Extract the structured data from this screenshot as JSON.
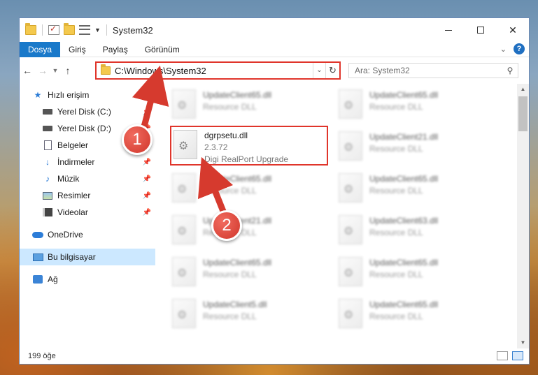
{
  "window": {
    "title": "System32"
  },
  "ribbon": {
    "tabs": [
      "Dosya",
      "Giriş",
      "Paylaş",
      "Görünüm"
    ],
    "active_index": 0
  },
  "address": {
    "path": "C:\\Windows\\System32"
  },
  "search": {
    "placeholder": "Ara: System32"
  },
  "sidebar": {
    "items": [
      {
        "label": "Hızlı erişim",
        "icon": "star-icon"
      },
      {
        "label": "Yerel Disk (C:)",
        "icon": "drive-icon",
        "pinned": true
      },
      {
        "label": "Yerel Disk (D:)",
        "icon": "drive-icon",
        "pinned": true
      },
      {
        "label": "Belgeler",
        "icon": "documents-icon",
        "pinned": true
      },
      {
        "label": "İndirmeler",
        "icon": "downloads-icon",
        "pinned": true
      },
      {
        "label": "Müzik",
        "icon": "music-icon",
        "pinned": true
      },
      {
        "label": "Resimler",
        "icon": "pictures-icon",
        "pinned": true
      },
      {
        "label": "Videolar",
        "icon": "videos-icon",
        "pinned": true
      },
      {
        "label": "OneDrive",
        "icon": "onedrive-icon"
      },
      {
        "label": "Bu bilgisayar",
        "icon": "this-pc-icon",
        "selected": true
      },
      {
        "label": "Ağ",
        "icon": "network-icon"
      }
    ]
  },
  "files": [
    {
      "name": "UpdateClient65.dll",
      "desc": "Resource DLL"
    },
    {
      "name": "UpdateClient65.dll",
      "desc": "Resource DLL"
    },
    {
      "name": "dgrpsetu.dll",
      "version": "2.3.72",
      "desc": "Digi RealPort Upgrade"
    },
    {
      "name": "UpdateClient21.dll",
      "desc": "Resource DLL"
    },
    {
      "name": "UpdateClient65.dll",
      "desc": "Resource DLL"
    },
    {
      "name": "UpdateClient65.dll",
      "desc": "Resource DLL"
    },
    {
      "name": "UpdateClient21.dll",
      "desc": "Resource DLL"
    },
    {
      "name": "UpdateClient63.dll",
      "desc": "Resource DLL"
    },
    {
      "name": "UpdateClient65.dll",
      "desc": "Resource DLL"
    },
    {
      "name": "UpdateClient65.dll",
      "desc": "Resource DLL"
    },
    {
      "name": "UpdateClient5.dll",
      "desc": "Resource DLL"
    },
    {
      "name": "UpdateClient65.dll",
      "desc": "Resource DLL"
    }
  ],
  "status": {
    "count": "199 öğe"
  },
  "callouts": [
    "1",
    "2"
  ],
  "colors": {
    "accent": "#1979ca",
    "highlight": "#e0352b",
    "selected": "#cce8ff"
  }
}
